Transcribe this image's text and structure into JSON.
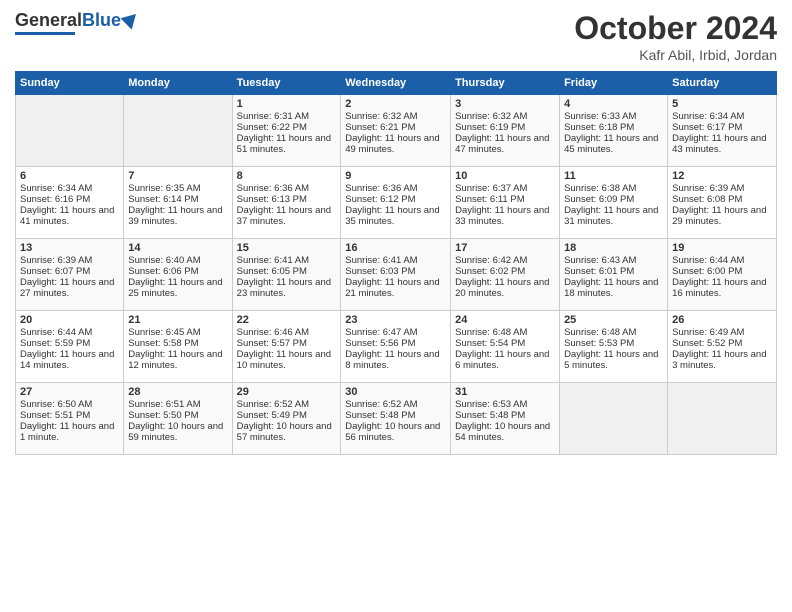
{
  "header": {
    "logo_general": "General",
    "logo_blue": "Blue",
    "month_title": "October 2024",
    "location": "Kafr Abil, Irbid, Jordan"
  },
  "weekdays": [
    "Sunday",
    "Monday",
    "Tuesday",
    "Wednesday",
    "Thursday",
    "Friday",
    "Saturday"
  ],
  "weeks": [
    [
      {
        "day": "",
        "empty": true
      },
      {
        "day": "",
        "empty": true
      },
      {
        "day": "1",
        "sunrise": "Sunrise: 6:31 AM",
        "sunset": "Sunset: 6:22 PM",
        "daylight": "Daylight: 11 hours and 51 minutes."
      },
      {
        "day": "2",
        "sunrise": "Sunrise: 6:32 AM",
        "sunset": "Sunset: 6:21 PM",
        "daylight": "Daylight: 11 hours and 49 minutes."
      },
      {
        "day": "3",
        "sunrise": "Sunrise: 6:32 AM",
        "sunset": "Sunset: 6:19 PM",
        "daylight": "Daylight: 11 hours and 47 minutes."
      },
      {
        "day": "4",
        "sunrise": "Sunrise: 6:33 AM",
        "sunset": "Sunset: 6:18 PM",
        "daylight": "Daylight: 11 hours and 45 minutes."
      },
      {
        "day": "5",
        "sunrise": "Sunrise: 6:34 AM",
        "sunset": "Sunset: 6:17 PM",
        "daylight": "Daylight: 11 hours and 43 minutes."
      }
    ],
    [
      {
        "day": "6",
        "sunrise": "Sunrise: 6:34 AM",
        "sunset": "Sunset: 6:16 PM",
        "daylight": "Daylight: 11 hours and 41 minutes."
      },
      {
        "day": "7",
        "sunrise": "Sunrise: 6:35 AM",
        "sunset": "Sunset: 6:14 PM",
        "daylight": "Daylight: 11 hours and 39 minutes."
      },
      {
        "day": "8",
        "sunrise": "Sunrise: 6:36 AM",
        "sunset": "Sunset: 6:13 PM",
        "daylight": "Daylight: 11 hours and 37 minutes."
      },
      {
        "day": "9",
        "sunrise": "Sunrise: 6:36 AM",
        "sunset": "Sunset: 6:12 PM",
        "daylight": "Daylight: 11 hours and 35 minutes."
      },
      {
        "day": "10",
        "sunrise": "Sunrise: 6:37 AM",
        "sunset": "Sunset: 6:11 PM",
        "daylight": "Daylight: 11 hours and 33 minutes."
      },
      {
        "day": "11",
        "sunrise": "Sunrise: 6:38 AM",
        "sunset": "Sunset: 6:09 PM",
        "daylight": "Daylight: 11 hours and 31 minutes."
      },
      {
        "day": "12",
        "sunrise": "Sunrise: 6:39 AM",
        "sunset": "Sunset: 6:08 PM",
        "daylight": "Daylight: 11 hours and 29 minutes."
      }
    ],
    [
      {
        "day": "13",
        "sunrise": "Sunrise: 6:39 AM",
        "sunset": "Sunset: 6:07 PM",
        "daylight": "Daylight: 11 hours and 27 minutes."
      },
      {
        "day": "14",
        "sunrise": "Sunrise: 6:40 AM",
        "sunset": "Sunset: 6:06 PM",
        "daylight": "Daylight: 11 hours and 25 minutes."
      },
      {
        "day": "15",
        "sunrise": "Sunrise: 6:41 AM",
        "sunset": "Sunset: 6:05 PM",
        "daylight": "Daylight: 11 hours and 23 minutes."
      },
      {
        "day": "16",
        "sunrise": "Sunrise: 6:41 AM",
        "sunset": "Sunset: 6:03 PM",
        "daylight": "Daylight: 11 hours and 21 minutes."
      },
      {
        "day": "17",
        "sunrise": "Sunrise: 6:42 AM",
        "sunset": "Sunset: 6:02 PM",
        "daylight": "Daylight: 11 hours and 20 minutes."
      },
      {
        "day": "18",
        "sunrise": "Sunrise: 6:43 AM",
        "sunset": "Sunset: 6:01 PM",
        "daylight": "Daylight: 11 hours and 18 minutes."
      },
      {
        "day": "19",
        "sunrise": "Sunrise: 6:44 AM",
        "sunset": "Sunset: 6:00 PM",
        "daylight": "Daylight: 11 hours and 16 minutes."
      }
    ],
    [
      {
        "day": "20",
        "sunrise": "Sunrise: 6:44 AM",
        "sunset": "Sunset: 5:59 PM",
        "daylight": "Daylight: 11 hours and 14 minutes."
      },
      {
        "day": "21",
        "sunrise": "Sunrise: 6:45 AM",
        "sunset": "Sunset: 5:58 PM",
        "daylight": "Daylight: 11 hours and 12 minutes."
      },
      {
        "day": "22",
        "sunrise": "Sunrise: 6:46 AM",
        "sunset": "Sunset: 5:57 PM",
        "daylight": "Daylight: 11 hours and 10 minutes."
      },
      {
        "day": "23",
        "sunrise": "Sunrise: 6:47 AM",
        "sunset": "Sunset: 5:56 PM",
        "daylight": "Daylight: 11 hours and 8 minutes."
      },
      {
        "day": "24",
        "sunrise": "Sunrise: 6:48 AM",
        "sunset": "Sunset: 5:54 PM",
        "daylight": "Daylight: 11 hours and 6 minutes."
      },
      {
        "day": "25",
        "sunrise": "Sunrise: 6:48 AM",
        "sunset": "Sunset: 5:53 PM",
        "daylight": "Daylight: 11 hours and 5 minutes."
      },
      {
        "day": "26",
        "sunrise": "Sunrise: 6:49 AM",
        "sunset": "Sunset: 5:52 PM",
        "daylight": "Daylight: 11 hours and 3 minutes."
      }
    ],
    [
      {
        "day": "27",
        "sunrise": "Sunrise: 6:50 AM",
        "sunset": "Sunset: 5:51 PM",
        "daylight": "Daylight: 11 hours and 1 minute."
      },
      {
        "day": "28",
        "sunrise": "Sunrise: 6:51 AM",
        "sunset": "Sunset: 5:50 PM",
        "daylight": "Daylight: 10 hours and 59 minutes."
      },
      {
        "day": "29",
        "sunrise": "Sunrise: 6:52 AM",
        "sunset": "Sunset: 5:49 PM",
        "daylight": "Daylight: 10 hours and 57 minutes."
      },
      {
        "day": "30",
        "sunrise": "Sunrise: 6:52 AM",
        "sunset": "Sunset: 5:48 PM",
        "daylight": "Daylight: 10 hours and 56 minutes."
      },
      {
        "day": "31",
        "sunrise": "Sunrise: 6:53 AM",
        "sunset": "Sunset: 5:48 PM",
        "daylight": "Daylight: 10 hours and 54 minutes."
      },
      {
        "day": "",
        "empty": true
      },
      {
        "day": "",
        "empty": true
      }
    ]
  ]
}
